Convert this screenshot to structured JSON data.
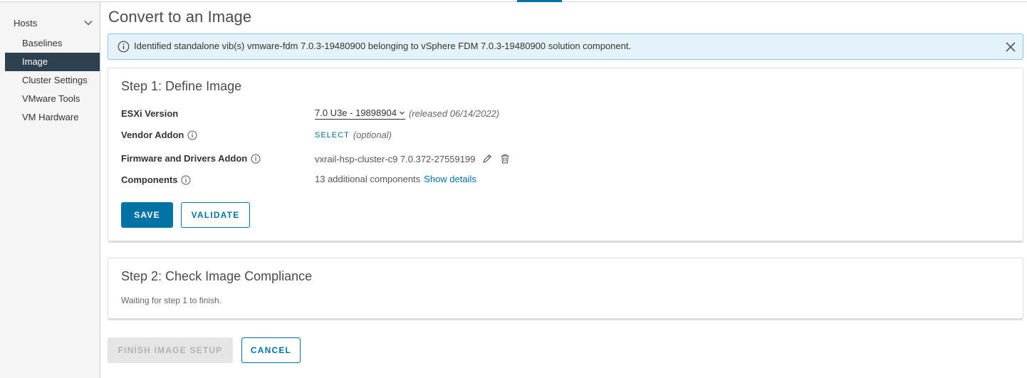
{
  "sidebar": {
    "header": "Hosts",
    "items": [
      {
        "label": "Baselines",
        "active": false
      },
      {
        "label": "Image",
        "active": true
      },
      {
        "label": "Cluster Settings",
        "active": false
      },
      {
        "label": "VMware Tools",
        "active": false
      },
      {
        "label": "VM Hardware",
        "active": false
      }
    ]
  },
  "page": {
    "title": "Convert to an Image"
  },
  "alert": {
    "text": "Identified standalone vib(s) vmware-fdm 7.0.3-19480900 belonging to vSphere FDM 7.0.3-19480900 solution component."
  },
  "step1": {
    "title": "Step 1: Define Image",
    "esxi": {
      "label": "ESXi Version",
      "value": "7.0 U3e - 19898904",
      "note": "(released 06/14/2022)"
    },
    "vendor": {
      "label": "Vendor Addon",
      "select": "SELECT",
      "note": "(optional)"
    },
    "firmware": {
      "label": "Firmware and Drivers Addon",
      "value": "vxrail-hsp-cluster-c9 7.0.372-27559199"
    },
    "components": {
      "label": "Components",
      "value": "13 additional components",
      "link": "Show details"
    },
    "save": "SAVE",
    "validate": "VALIDATE"
  },
  "step2": {
    "title": "Step 2: Check Image Compliance",
    "status": "Waiting for step 1 to finish."
  },
  "footer": {
    "finish": "FINISH IMAGE SETUP",
    "cancel": "CANCEL"
  },
  "colors": {
    "accent": "#0072a3",
    "sidebar_active": "#2d4050",
    "alert_bg": "#e3f3f9"
  }
}
